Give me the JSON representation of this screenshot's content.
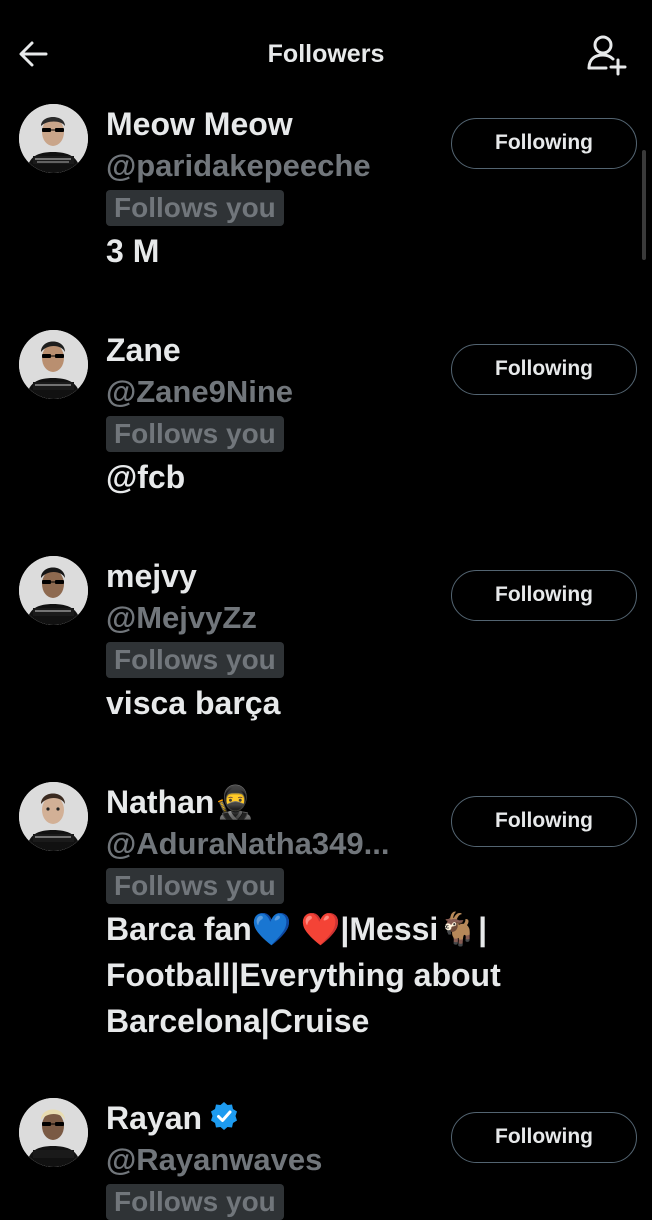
{
  "header": {
    "title": "Followers",
    "back_icon": "arrow-left-icon",
    "add_icon": "add-user-icon"
  },
  "colors": {
    "background": "#000000",
    "primary_text": "#e7e9ea",
    "secondary_text": "#71767b",
    "badge_bg": "#2f3336",
    "button_border": "#536471",
    "verified": "#1d9bf0"
  },
  "users": [
    {
      "name": "Meow Meow",
      "handle": "@paridakepeeche",
      "badge": "Follows you",
      "bio": "3 M",
      "button": "Following"
    },
    {
      "name": "Zane",
      "handle": "@Zane9Nine",
      "badge": "Follows you",
      "bio": "@fcb",
      "button": "Following"
    },
    {
      "name": "mejvy",
      "handle": "@MejvyZz",
      "badge": "Follows you",
      "bio": "visca barça",
      "button": "Following"
    },
    {
      "name": "Nathan",
      "name_emoji": "🥷",
      "handle": "@AduraNatha349...",
      "badge": "Follows you",
      "bio": {
        "part1": "Barca fan",
        "blue_heart": "💙",
        "red_heart": "❤️",
        "part2": "|Messi",
        "goat": "🐐",
        "part3": "| Football|Everything about Barcelona|Cruise"
      },
      "button": "Following"
    },
    {
      "name": "Rayan",
      "verified_icon": "verified-badge-icon",
      "handle": "@Rayanwaves",
      "badge": "Follows you",
      "button": "Following"
    }
  ]
}
